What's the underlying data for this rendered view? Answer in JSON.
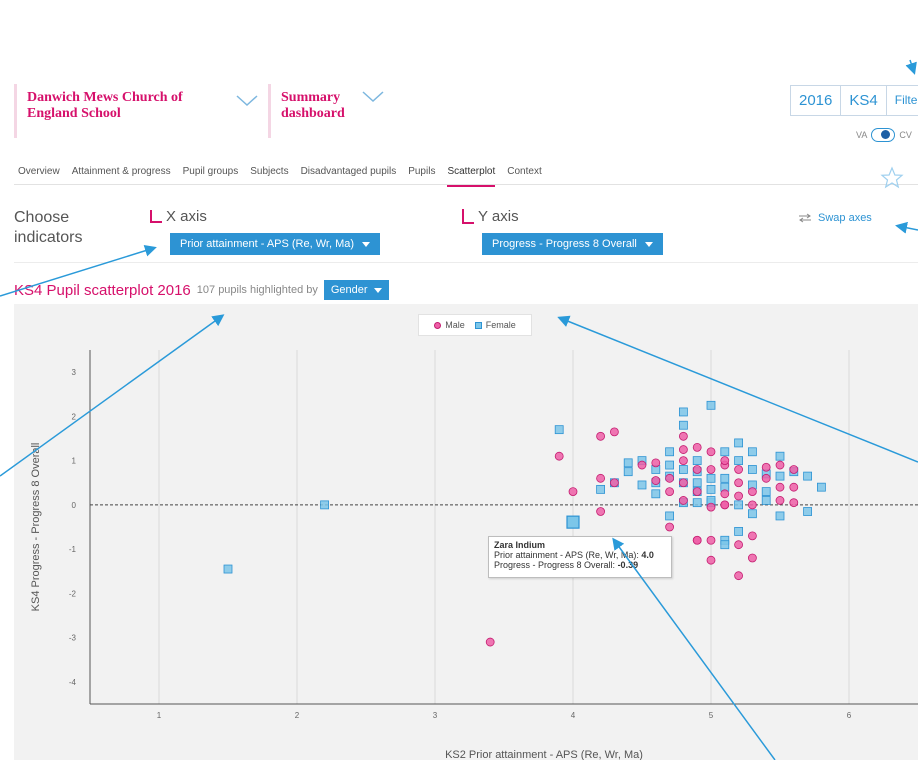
{
  "header": {
    "school_name": "Danwich Mews Church of England School",
    "dashboard_name": "Summary dashboard",
    "year": "2016",
    "key_stage": "KS4",
    "filter_label": "Filter",
    "toggle_left": "VA",
    "toggle_right": "CV"
  },
  "tabs": [
    {
      "label": "Overview"
    },
    {
      "label": "Attainment & progress"
    },
    {
      "label": "Pupil groups"
    },
    {
      "label": "Subjects"
    },
    {
      "label": "Disadvantaged pupils"
    },
    {
      "label": "Pupils"
    },
    {
      "label": "Scatterplot",
      "active": true
    },
    {
      "label": "Context"
    }
  ],
  "indicators": {
    "choose_label": "Choose indicators",
    "x_axis_label": "X axis",
    "x_axis_value": "Prior attainment - APS (Re, Wr, Ma)",
    "y_axis_label": "Y axis",
    "y_axis_value": "Progress - Progress 8 Overall",
    "swap_label": "Swap axes"
  },
  "scatter": {
    "title": "KS4 Pupil scatterplot 2016",
    "subtitle": "107 pupils highlighted by",
    "highlight_by": "Gender"
  },
  "tooltip": {
    "name": "Zara Indium",
    "line1_label": "Prior attainment - APS (Re, Wr, Ma):",
    "line1_value": "4.0",
    "line2_label": "Progress - Progress 8 Overall:",
    "line2_value": "-0.39"
  },
  "colors": {
    "brand_pink": "#d6106b",
    "accent_blue": "#2d93d3",
    "male": "#ee5fa7",
    "female": "#7cc6e9"
  },
  "chart_data": {
    "type": "scatter",
    "xlabel": "KS2 Prior attainment - APS (Re, Wr, Ma)",
    "ylabel": "KS4 Progress - Progress 8 Overall",
    "xlim": [
      0.5,
      6.5
    ],
    "ylim": [
      -4.5,
      3.5
    ],
    "xticks": [
      "1",
      "2",
      "3",
      "4",
      "5",
      "6"
    ],
    "yticks": [
      "3",
      "2",
      "1",
      "0",
      "-1",
      "-2",
      "-3",
      "-4"
    ],
    "legend": [
      "Male",
      "Female"
    ],
    "legend_position": "top-center",
    "grid": true,
    "series": [
      {
        "name": "Male",
        "points": [
          [
            3.9,
            1.1
          ],
          [
            4.2,
            1.55
          ],
          [
            4.3,
            1.65
          ],
          [
            4.0,
            0.3
          ],
          [
            4.2,
            0.6
          ],
          [
            4.2,
            -0.15
          ],
          [
            4.3,
            0.5
          ],
          [
            4.5,
            0.9
          ],
          [
            4.6,
            0.95
          ],
          [
            4.6,
            0.55
          ],
          [
            4.7,
            0.6
          ],
          [
            4.7,
            0.3
          ],
          [
            4.7,
            -0.5
          ],
          [
            4.5,
            -1.0
          ],
          [
            4.8,
            1.0
          ],
          [
            4.8,
            0.5
          ],
          [
            4.8,
            1.55
          ],
          [
            4.9,
            0.8
          ],
          [
            4.9,
            1.3
          ],
          [
            4.9,
            0.3
          ],
          [
            4.9,
            -0.8
          ],
          [
            5.0,
            1.2
          ],
          [
            5.0,
            0.8
          ],
          [
            5.0,
            -0.05
          ],
          [
            5.0,
            -0.8
          ],
          [
            5.0,
            -1.25
          ],
          [
            5.1,
            0.9
          ],
          [
            5.1,
            0.0
          ],
          [
            5.1,
            0.25
          ],
          [
            5.1,
            1.0
          ],
          [
            5.2,
            0.8
          ],
          [
            5.2,
            0.5
          ],
          [
            5.2,
            0.2
          ],
          [
            5.2,
            -0.9
          ],
          [
            5.2,
            -1.6
          ],
          [
            5.3,
            0.3
          ],
          [
            5.3,
            0.0
          ],
          [
            5.3,
            -0.7
          ],
          [
            5.3,
            -1.2
          ],
          [
            5.4,
            0.85
          ],
          [
            5.4,
            0.6
          ],
          [
            5.5,
            0.4
          ],
          [
            5.5,
            0.1
          ],
          [
            5.5,
            0.9
          ],
          [
            5.6,
            0.05
          ],
          [
            5.6,
            0.8
          ],
          [
            5.6,
            0.4
          ],
          [
            4.8,
            0.1
          ],
          [
            4.8,
            1.25
          ],
          [
            5.1,
            0.0
          ],
          [
            4.9,
            -0.8
          ],
          [
            3.4,
            -3.1
          ]
        ]
      },
      {
        "name": "Female",
        "points": [
          [
            1.5,
            -1.45
          ],
          [
            2.2,
            0.0
          ],
          [
            3.9,
            1.7
          ],
          [
            4.0,
            -0.39
          ],
          [
            4.2,
            0.35
          ],
          [
            4.3,
            0.5
          ],
          [
            4.4,
            0.75
          ],
          [
            4.4,
            0.95
          ],
          [
            4.5,
            1.0
          ],
          [
            4.6,
            0.8
          ],
          [
            4.6,
            0.5
          ],
          [
            4.7,
            0.9
          ],
          [
            4.7,
            1.2
          ],
          [
            4.7,
            0.65
          ],
          [
            4.7,
            -0.25
          ],
          [
            4.8,
            2.1
          ],
          [
            4.8,
            1.8
          ],
          [
            4.8,
            0.5
          ],
          [
            4.8,
            0.05
          ],
          [
            4.9,
            0.75
          ],
          [
            4.9,
            1.0
          ],
          [
            4.9,
            0.3
          ],
          [
            4.9,
            0.05
          ],
          [
            5.0,
            2.25
          ],
          [
            5.0,
            0.6
          ],
          [
            5.0,
            0.35
          ],
          [
            5.0,
            0.05
          ],
          [
            5.1,
            -0.8
          ],
          [
            5.1,
            1.2
          ],
          [
            5.1,
            0.4
          ],
          [
            5.1,
            0.6
          ],
          [
            5.2,
            1.4
          ],
          [
            5.2,
            1.0
          ],
          [
            5.2,
            -0.6
          ],
          [
            5.3,
            0.8
          ],
          [
            5.3,
            0.45
          ],
          [
            5.3,
            -0.2
          ],
          [
            5.3,
            1.2
          ],
          [
            5.4,
            0.7
          ],
          [
            5.4,
            0.3
          ],
          [
            5.5,
            1.1
          ],
          [
            5.5,
            0.65
          ],
          [
            5.5,
            -0.25
          ],
          [
            5.6,
            0.75
          ],
          [
            5.7,
            0.65
          ],
          [
            5.7,
            -0.15
          ],
          [
            5.8,
            0.4
          ],
          [
            5.1,
            -0.9
          ],
          [
            5.0,
            0.1
          ],
          [
            4.9,
            0.5
          ],
          [
            4.8,
            0.8
          ],
          [
            5.2,
            0.0
          ],
          [
            5.4,
            0.1
          ],
          [
            4.6,
            0.25
          ],
          [
            4.5,
            0.45
          ]
        ]
      }
    ]
  }
}
